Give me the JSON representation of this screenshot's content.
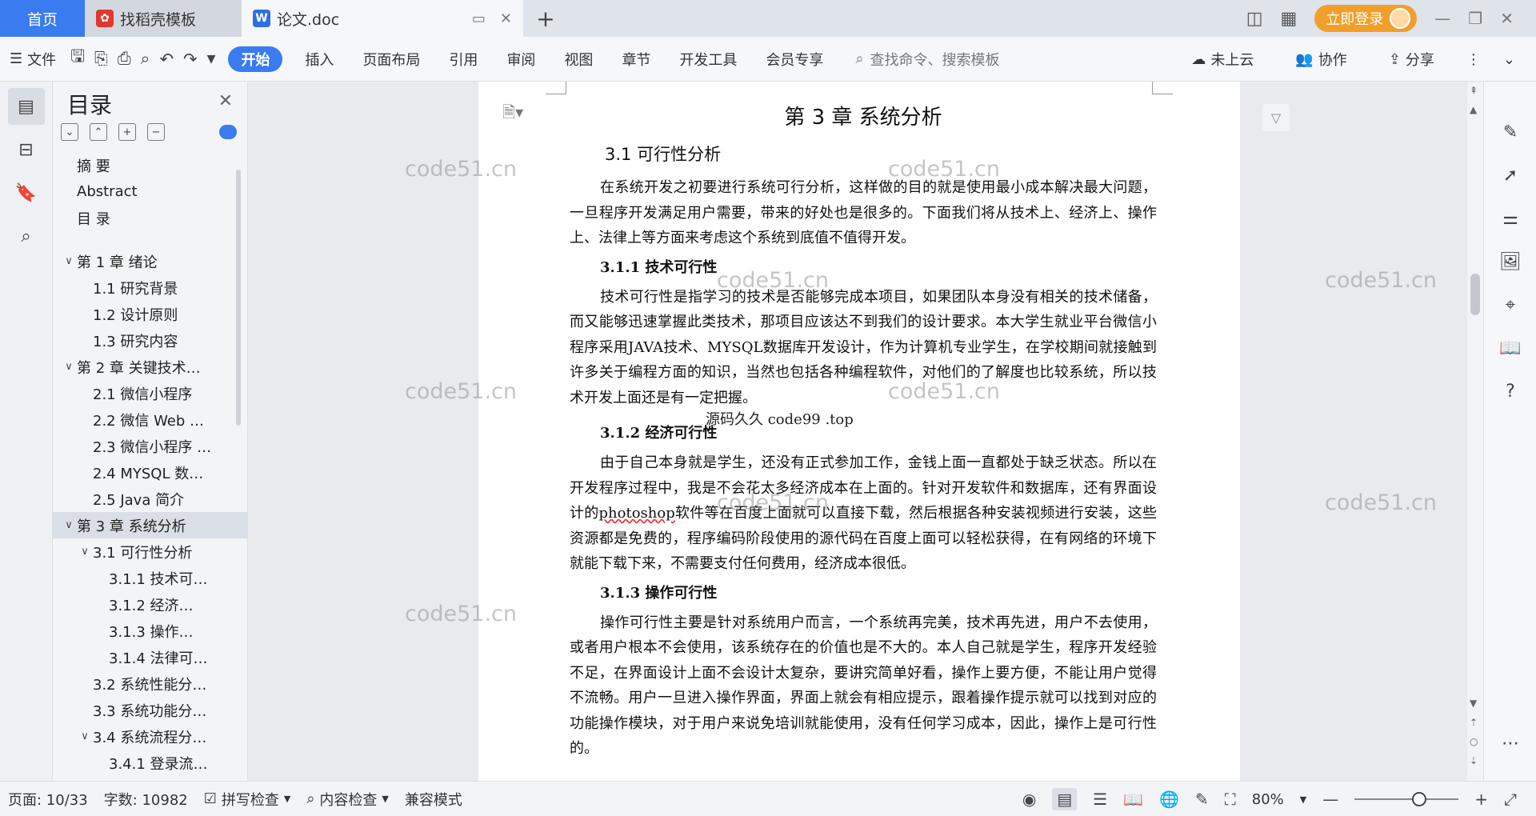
{
  "titlebar": {
    "home_tab": "首页",
    "tab_template": "找稻壳模板",
    "tab_doc": "论文.doc",
    "new_tab": "+",
    "login": "立即登录"
  },
  "toolbar": {
    "file": "文件",
    "start": "开始",
    "menus": [
      "插入",
      "页面布局",
      "引用",
      "审阅",
      "视图",
      "章节",
      "开发工具",
      "会员专享"
    ],
    "search_placeholder": "查找命令、搜索模板",
    "cloud": "未上云",
    "collab": "协作",
    "share": "分享"
  },
  "toc": {
    "title": "目录",
    "items": [
      {
        "text": "摘  要",
        "level": 0,
        "arrow": ""
      },
      {
        "text": "Abstract",
        "level": 0,
        "arrow": ""
      },
      {
        "text": "目    录",
        "level": 0,
        "arrow": ""
      },
      {
        "text": "第 1 章   绪论",
        "level": 0,
        "arrow": "∨",
        "gap": true
      },
      {
        "text": "1.1 研究背景",
        "level": 1,
        "arrow": ""
      },
      {
        "text": "1.2 设计原则",
        "level": 1,
        "arrow": ""
      },
      {
        "text": "1.3 研究内容",
        "level": 1,
        "arrow": ""
      },
      {
        "text": "第 2 章   关键技术…",
        "level": 0,
        "arrow": "∨"
      },
      {
        "text": "2.1  微信小程序",
        "level": 1,
        "arrow": ""
      },
      {
        "text": "2.2 微信 Web …",
        "level": 1,
        "arrow": ""
      },
      {
        "text": "2.3 微信小程序 …",
        "level": 1,
        "arrow": ""
      },
      {
        "text": "2.4 MYSQL 数…",
        "level": 1,
        "arrow": ""
      },
      {
        "text": "2.5 Java 简介",
        "level": 1,
        "arrow": ""
      },
      {
        "text": "第 3 章   系统分析",
        "level": 0,
        "arrow": "∨",
        "selected": true
      },
      {
        "text": "3.1  可行性分析",
        "level": 1,
        "arrow": "∨"
      },
      {
        "text": "3.1.1 技术可…",
        "level": 2,
        "arrow": ""
      },
      {
        "text": "3.1.2  经济…",
        "level": 2,
        "arrow": ""
      },
      {
        "text": "3.1.3  操作…",
        "level": 2,
        "arrow": ""
      },
      {
        "text": "3.1.4 法律可…",
        "level": 2,
        "arrow": ""
      },
      {
        "text": "3.2  系统性能分…",
        "level": 1,
        "arrow": ""
      },
      {
        "text": "3.3  系统功能分…",
        "level": 1,
        "arrow": ""
      },
      {
        "text": "3.4  系统流程分…",
        "level": 1,
        "arrow": "∨"
      },
      {
        "text": "3.4.1 登录流…",
        "level": 2,
        "arrow": ""
      }
    ]
  },
  "document": {
    "chapter_title": "第 3 章    系统分析",
    "section_title": "3.1  可行性分析",
    "para1": "在系统开发之初要进行系统可行分析，这样做的目的就是使用最小成本解决最大问题，一旦程序开发满足用户需要，带来的好处也是很多的。下面我们将从技术上、经济上、操作上、法律上等方面来考虑这个系统到底值不值得开发。",
    "sub1": "3.1.1 技术可行性",
    "para2": "技术可行性是指学习的技术是否能够完成本项目，如果团队本身没有相关的技术储备，而又能够迅速掌握此类技术，那项目应该达不到我们的设计要求。本大学生就业平台微信小程序采用JAVA技术、MYSQL数据库开发设计，作为计算机专业学生，在学校期间就接触到许多关于编程方面的知识，当然也包括各种编程软件，对他们的了解度也比较系统，所以技术开发上面还是有一定把握。",
    "overlay": "源码久久  code99 .top",
    "sub2": "3.1.2  经济可行性",
    "para3_a": "由于自己本身就是学生，还没有正式参加工作，金钱上面一直都处于缺乏状态。所以在开发程序过程中，我是不会花太多经济成本在上面的。针对开发软件和数据库，还有界面设计的",
    "para3_word": "photoshop",
    "para3_b": "软件等在百度上面就可以直接下载，然后根据各种安装视频进行安装，这些资源都是免费的，程序编码阶段使用的源代码在百度上面可以轻松获得，在有网络的环境下就能下载下来，不需要支付任何费用，经济成本很低。",
    "sub3": "3.1.3  操作可行性",
    "para4": "操作可行性主要是针对系统用户而言，一个系统再完美，技术再先进，用户不去使用，或者用户根本不会使用，该系统存在的价值也是不大的。本人自己就是学生，程序开发经验不足，在界面设计上面不会设计太复杂，要讲究简单好看，操作上要方便，不能让用户觉得不流畅。用户一旦进入操作界面，界面上就会有相应提示，跟着操作提示就可以找到对应的功能操作模块，对于用户来说免培训就能使用，没有任何学习成本，因此，操作上是可行性的。",
    "watermark": "code51.cn"
  },
  "status": {
    "page": "页面: 10/33",
    "words": "字数: 10982",
    "spell": "拼写检查",
    "content_check": "内容检查",
    "compat": "兼容模式",
    "zoom": "80%"
  },
  "colors": {
    "accent": "#3a7bf0",
    "login": "#f19f2a"
  }
}
